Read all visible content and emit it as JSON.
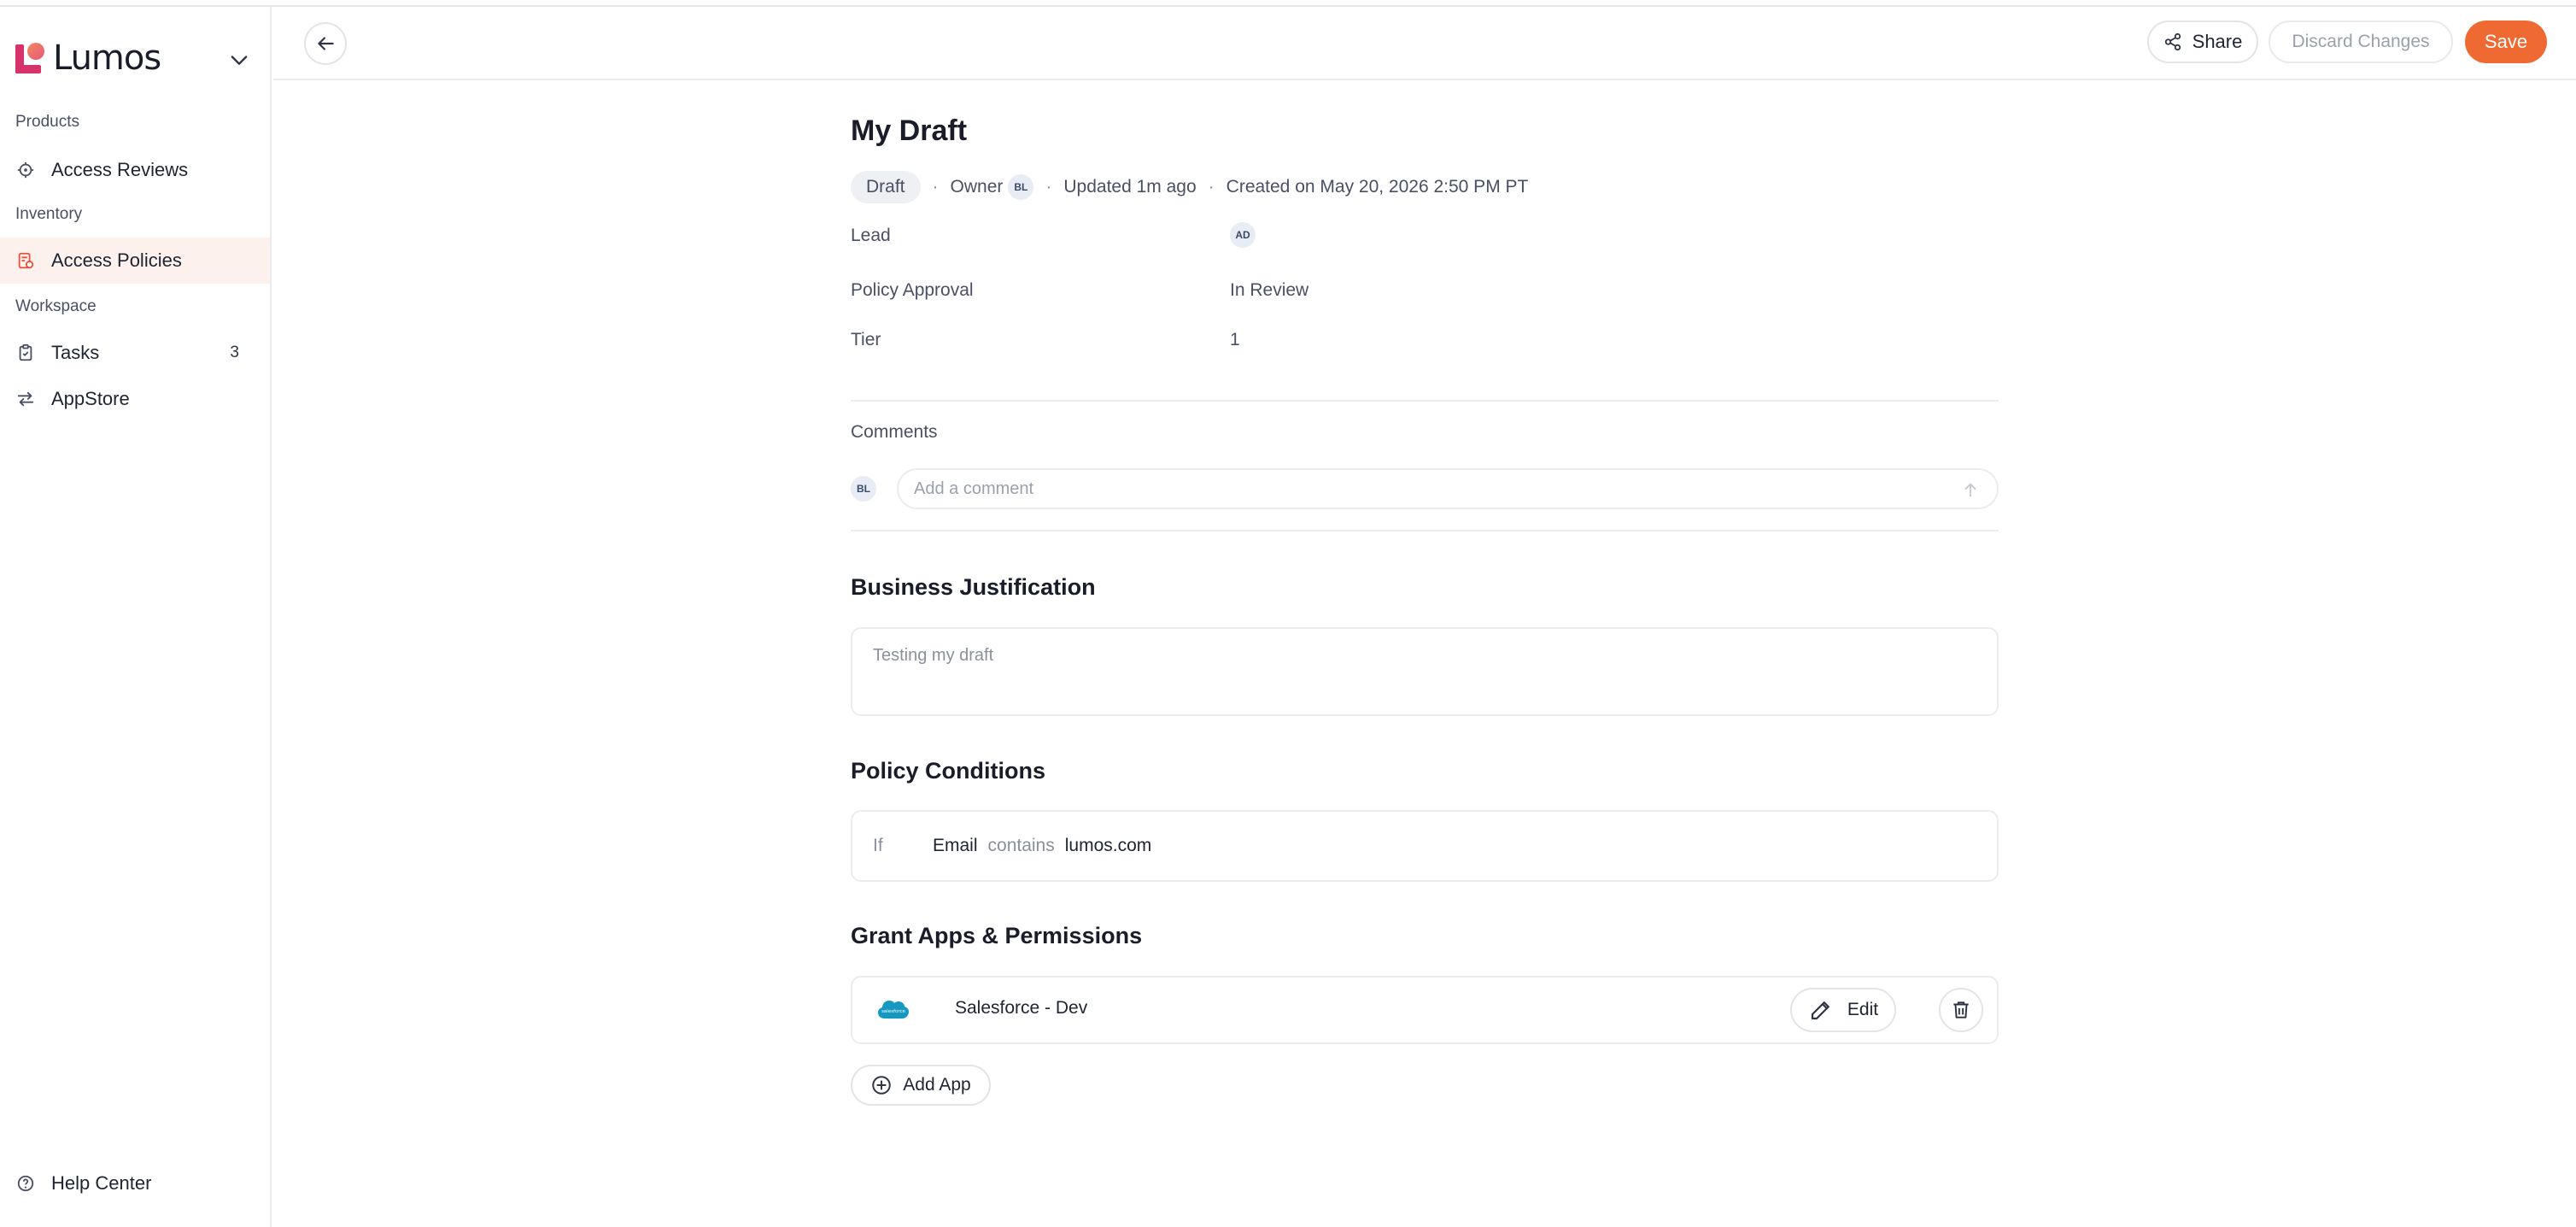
{
  "brand": {
    "name": "Lumos"
  },
  "sidebar": {
    "sections": [
      {
        "label": "Products"
      },
      {
        "label": "Inventory"
      },
      {
        "label": "Workspace"
      }
    ],
    "items": [
      {
        "label": "Access Reviews",
        "icon": "target-icon"
      },
      {
        "label": "Access Policies",
        "icon": "policy-icon",
        "active": true
      },
      {
        "label": "Tasks",
        "icon": "clipboard-icon",
        "count": "3"
      },
      {
        "label": "AppStore",
        "icon": "swap-arrows-icon"
      }
    ],
    "help": {
      "label": "Help Center",
      "icon": "help-circle-icon"
    }
  },
  "toolbar": {
    "share_label": "Share",
    "discard_label": "Discard Changes",
    "save_label": "Save"
  },
  "policy": {
    "title": "My Draft",
    "status": "Draft",
    "owner_label": "Owner",
    "owner_initials": "BL",
    "updated": "Updated 1m ago",
    "created": "Created on May 20, 2026 2:50 PM PT",
    "fields": {
      "lead_label": "Lead",
      "lead_initials": "AD",
      "approval_label": "Policy Approval",
      "approval_value": "In Review",
      "tier_label": "Tier",
      "tier_value": "1"
    }
  },
  "comments": {
    "title": "Comments",
    "user_initials": "BL",
    "placeholder": "Add a comment"
  },
  "justification": {
    "title": "Business Justification",
    "text": "Testing my draft"
  },
  "conditions": {
    "title": "Policy Conditions",
    "if_label": "If",
    "field": "Email",
    "operator": "contains",
    "value": "lumos.com"
  },
  "grants": {
    "title": "Grant Apps & Permissions",
    "apps": [
      {
        "name": "Salesforce - Dev",
        "logo_text": "salesforce",
        "edit_label": "Edit"
      }
    ],
    "add_label": "Add App"
  },
  "colors": {
    "accent": "#ef6a33",
    "active_nav_bg": "#fdf1ed",
    "brand_pink": "#d6336c",
    "salesforce_blue": "#1798c1"
  }
}
